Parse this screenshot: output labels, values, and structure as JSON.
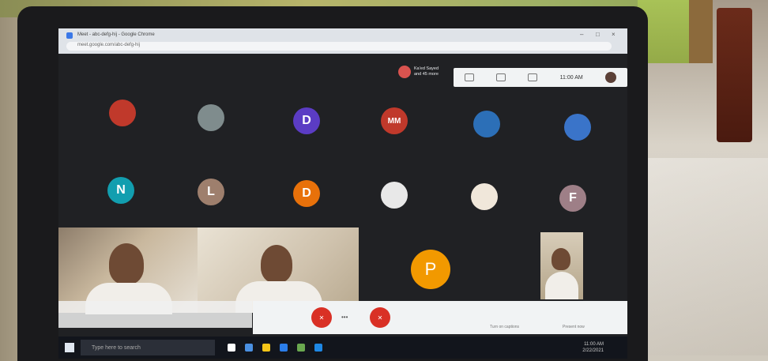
{
  "browser": {
    "tab_title": "Meet - abc-defg-hij - Google Chrome",
    "url": "meet.google.com/abc-defg-hij"
  },
  "presenter": {
    "line1": "Ka'ed Sayed",
    "line2": "and 45 more"
  },
  "toolbar": {
    "clock": "11:00 AM"
  },
  "participants": [
    {
      "initial": "",
      "color": "#c0392b"
    },
    {
      "initial": "",
      "color": "#7f8c8d"
    },
    {
      "initial": "D",
      "color": "#5b3cc4"
    },
    {
      "initial": "MM",
      "color": "#c0392b"
    },
    {
      "initial": "",
      "color": "#2c6fb7"
    },
    {
      "initial": "",
      "color": "#3a74c9"
    },
    {
      "initial": "N",
      "color": "#129eaf"
    },
    {
      "initial": "L",
      "color": "#9e7f6d"
    },
    {
      "initial": "D",
      "color": "#e8710a"
    },
    {
      "initial": "",
      "color": "#e8e8e8"
    },
    {
      "initial": "",
      "color": "#f0e7da"
    },
    {
      "initial": "F",
      "color": "#9e7f87"
    }
  ],
  "featured": {
    "initial": "P",
    "color": "#f29900"
  },
  "controls": {
    "mic_label": "",
    "end_label": "",
    "present_label": "Present now",
    "caption_label": "Turn on captions"
  },
  "taskbar": {
    "search_placeholder": "Type here to search",
    "time": "11:00 AM",
    "date": "2/22/2021"
  },
  "colors": {
    "meet_bg": "#202124",
    "end_call": "#d93025",
    "bezel": "#1a1a1c"
  }
}
